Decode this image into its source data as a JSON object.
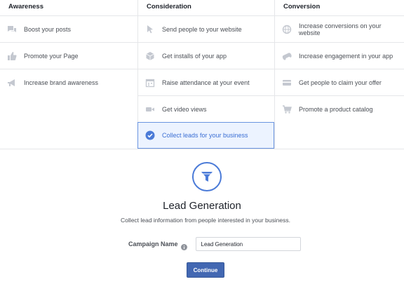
{
  "columns": [
    {
      "heading": "Awareness",
      "items": [
        {
          "label": "Boost your posts",
          "icon": "speech-bubbles-icon"
        },
        {
          "label": "Promote your Page",
          "icon": "thumbs-up-icon"
        },
        {
          "label": "Increase brand awareness",
          "icon": "megaphone-icon"
        }
      ]
    },
    {
      "heading": "Consideration",
      "items": [
        {
          "label": "Send people to your website",
          "icon": "cursor-icon"
        },
        {
          "label": "Get installs of your app",
          "icon": "box-icon"
        },
        {
          "label": "Raise attendance at your event",
          "icon": "calendar-icon"
        },
        {
          "label": "Get video views",
          "icon": "video-camera-icon"
        },
        {
          "label": "Collect leads for your business",
          "icon": "check-circle-icon",
          "selected": true
        }
      ]
    },
    {
      "heading": "Conversion",
      "items": [
        {
          "label": "Increase conversions on your website",
          "icon": "globe-icon"
        },
        {
          "label": "Increase engagement in your app",
          "icon": "gamepad-icon"
        },
        {
          "label": "Get people to claim your offer",
          "icon": "offer-card-icon"
        },
        {
          "label": "Promote a product catalog",
          "icon": "shopping-cart-icon"
        }
      ]
    }
  ],
  "detail": {
    "icon": "funnel-icon",
    "title": "Lead Generation",
    "description": "Collect lead information from people interested in your business."
  },
  "campaign": {
    "label": "Campaign Name",
    "value": "Lead Generation"
  },
  "continue_label": "Continue",
  "colors": {
    "accent": "#4267b2",
    "selected_bg": "#ecf3ff",
    "selected_border": "#6a94e0",
    "icon_gray": "#c4c8d0"
  }
}
